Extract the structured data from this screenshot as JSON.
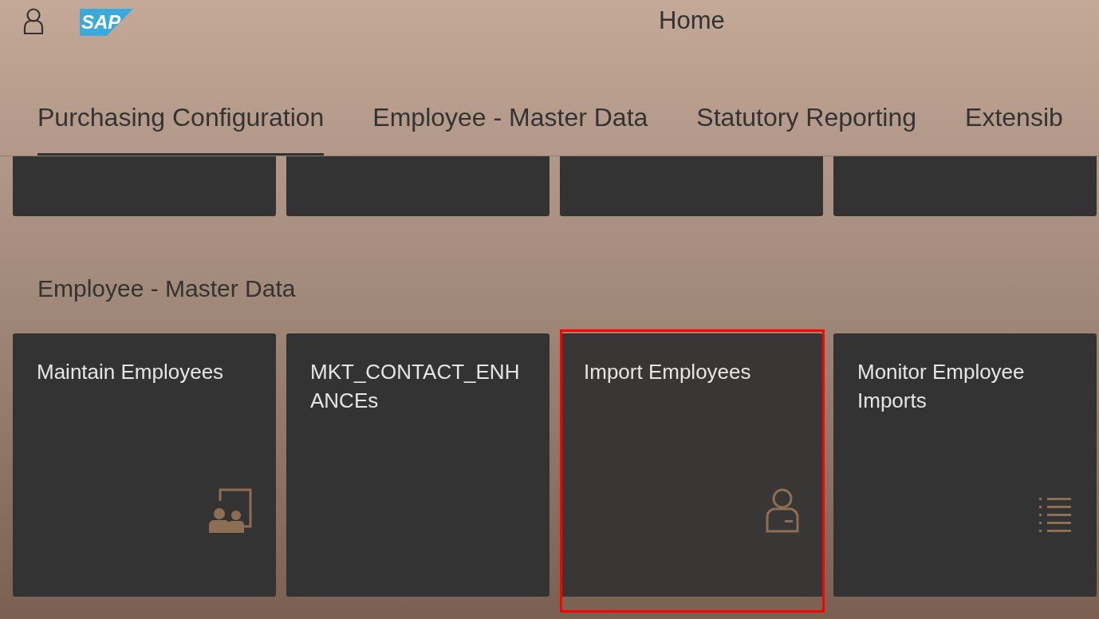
{
  "header": {
    "logo_text": "SAP",
    "title": "Home"
  },
  "tabs": [
    {
      "label": "Purchasing Configuration",
      "selected": true
    },
    {
      "label": "Employee - Master Data",
      "selected": false
    },
    {
      "label": "Statutory Reporting",
      "selected": false
    },
    {
      "label": "Extensib",
      "selected": false
    }
  ],
  "upper_group": {
    "tiles": [
      {
        "kind": "blank"
      },
      {
        "kind": "blank"
      },
      {
        "kind": "blank"
      },
      {
        "kind": "blank"
      }
    ]
  },
  "section": {
    "title": "Employee - Master Data",
    "tiles": [
      {
        "title": "Maintain Employees",
        "kind": "people",
        "highlighted": false
      },
      {
        "title": "MKT_CONTACT_ENHANCEs",
        "kind": "plain",
        "highlighted": false
      },
      {
        "title": "Import Employees",
        "kind": "person",
        "highlighted": true
      },
      {
        "title": "Monitor Employee Imports",
        "kind": "list",
        "highlighted": false
      }
    ]
  }
}
